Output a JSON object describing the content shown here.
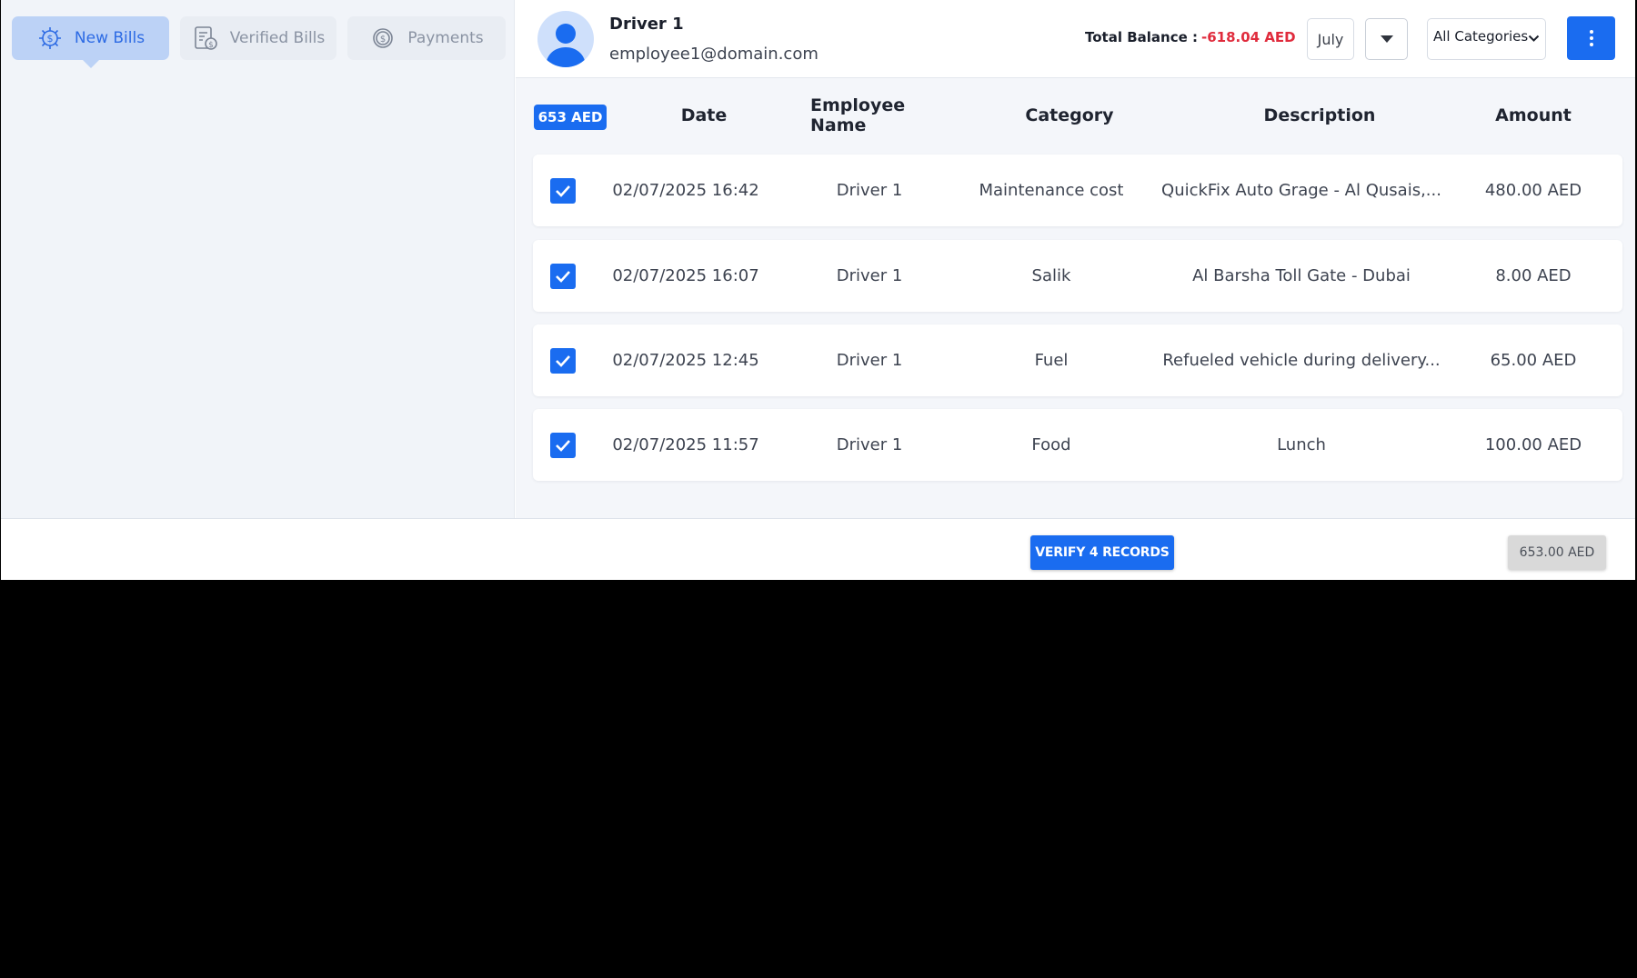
{
  "tabs": [
    {
      "label": "New Bills",
      "icon": "gear-dollar-icon",
      "active": true
    },
    {
      "label": "Verified Bills",
      "icon": "verified-bill-icon",
      "active": false
    },
    {
      "label": "Payments",
      "icon": "dollar-coin-icon",
      "active": false
    }
  ],
  "header": {
    "user_name": "Driver 1",
    "user_email": "employee1@domain.com",
    "balance_label": "Total Balance :",
    "balance_value": "-618.04 AED",
    "month": "July",
    "category": "All Categories"
  },
  "table": {
    "total_badge": "653 AED",
    "columns": [
      "Date",
      "Employee Name",
      "Category",
      "Description",
      "Amount"
    ],
    "rows": [
      {
        "checked": true,
        "date": "02/07/2025 16:42",
        "employee": "Driver 1",
        "category": "Maintenance cost",
        "description": "QuickFix Auto Grage - Al Qusais,...",
        "amount": "480.00 AED"
      },
      {
        "checked": true,
        "date": "02/07/2025 16:07",
        "employee": "Driver 1",
        "category": "Salik",
        "description": "Al Barsha Toll Gate - Dubai",
        "amount": "8.00 AED"
      },
      {
        "checked": true,
        "date": "02/07/2025 12:45",
        "employee": "Driver 1",
        "category": "Fuel",
        "description": "Refueled vehicle during delivery...",
        "amount": "65.00 AED"
      },
      {
        "checked": true,
        "date": "02/07/2025 11:57",
        "employee": "Driver 1",
        "category": "Food",
        "description": "Lunch",
        "amount": "100.00 AED"
      }
    ]
  },
  "footer": {
    "verify_label": "VERIFY 4 RECORDS",
    "total": "653.00 AED"
  },
  "colors": {
    "accent": "#1a6cf0",
    "negative": "#e02b3c",
    "active_tab_bg": "#bcd2f6"
  }
}
